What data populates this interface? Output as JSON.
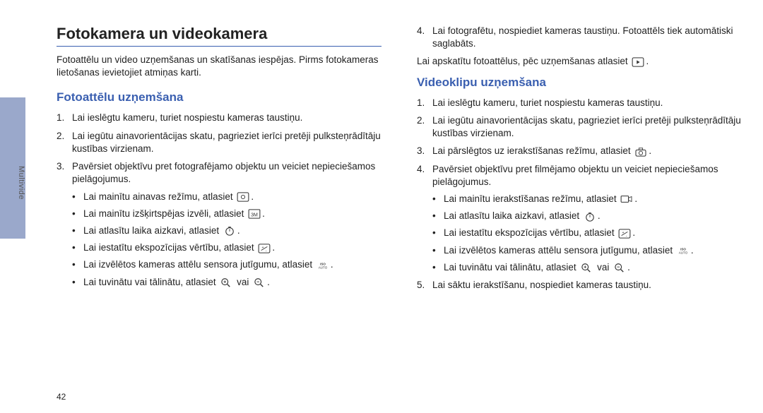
{
  "sidebar": {
    "label": "Multivide"
  },
  "page_number": "42",
  "left": {
    "main_title": "Fotokamera un videokamera",
    "intro": "Fotoattēlu un video uzņemšanas un skatīšanas iespējas. Pirms fotokameras lietošanas ievietojiet atmiņas karti.",
    "sub_title": "Fotoattēlu uzņemšana",
    "items": [
      "Lai ieslēgtu kameru, turiet nospiestu kameras taustiņu.",
      "Lai iegūtu ainavorientācijas skatu, pagrieziet ierīci pretēji pulksteņrādītāju kustības virzienam.",
      "Pavērsiet objektīvu pret fotografējamo objektu un veiciet nepieciešamos pielāgojumus."
    ],
    "bullets": [
      {
        "prefix": "Lai mainītu ainavas režīmu, atlasiet ",
        "icon": "scene-icon"
      },
      {
        "prefix": "Lai mainītu izšķirtspējas izvēli, atlasiet ",
        "icon": "resolution-icon"
      },
      {
        "prefix": "Lai atlasītu laika aizkavi, atlasiet ",
        "icon": "timer-icon"
      },
      {
        "prefix": "Lai iestatītu ekspozīcijas vērtību, atlasiet ",
        "icon": "exposure-icon"
      },
      {
        "prefix": "Lai izvēlētos kameras attēlu sensora jutīgumu, atlasiet ",
        "icon": "iso-icon"
      },
      {
        "prefix": "Lai tuvinātu vai tālinātu, atlasiet ",
        "icon": "zoom-in-icon",
        "middle": " vai ",
        "icon2": "zoom-out-icon"
      }
    ]
  },
  "right": {
    "step4": "Lai fotografētu, nospiediet kameras taustiņu. Fotoattēls tiek automātiski saglabāts.",
    "after4_prefix": "Lai apskatītu fotoattēlus, pēc uzņemšanas atlasiet ",
    "sub_title": "Videoklipu uzņemšana",
    "items": [
      "Lai ieslēgtu kameru, turiet nospiestu kameras taustiņu.",
      "Lai iegūtu ainavorientācijas skatu, pagrieziet ierīci pretēji pulksteņrādītāju kustības virzienam.",
      "Lai pārslēgtos uz ierakstīšanas režīmu, atlasiet ",
      "Pavērsiet objektīvu pret filmējamo objektu un veiciet nepieciešamos pielāgojumus."
    ],
    "bullets": [
      {
        "prefix": "Lai mainītu ierakstīšanas režīmu, atlasiet ",
        "icon": "record-mode-icon"
      },
      {
        "prefix": "Lai atlasītu laika aizkavi, atlasiet ",
        "icon": "timer-icon"
      },
      {
        "prefix": "Lai iestatītu ekspozīcijas vērtību, atlasiet ",
        "icon": "exposure-icon"
      },
      {
        "prefix": "Lai izvēlētos kameras attēlu sensora jutīgumu, atlasiet ",
        "icon": "iso-icon"
      },
      {
        "prefix": "Lai tuvinātu vai tālinātu, atlasiet ",
        "icon": "zoom-in-icon",
        "middle": " vai ",
        "icon2": "zoom-out-icon"
      }
    ],
    "item5": "Lai sāktu ierakstīšanu, nospiediet kameras taustiņu."
  }
}
